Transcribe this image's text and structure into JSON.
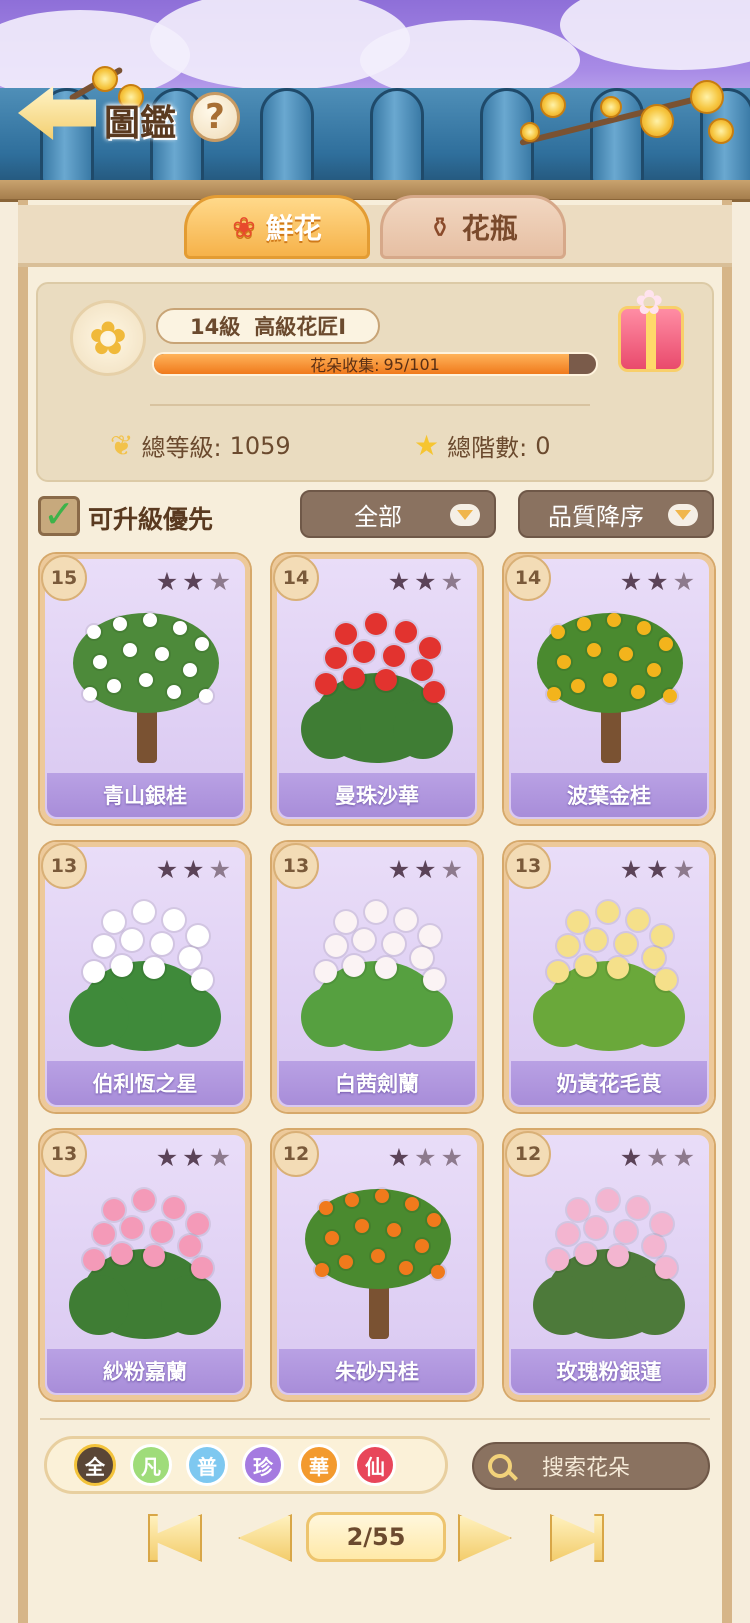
{
  "header": {
    "title": "圖鑑",
    "help_label": "?"
  },
  "tabs": [
    {
      "label": "鮮花",
      "icon": "rose-icon",
      "active": true
    },
    {
      "label": "花瓶",
      "icon": "vase-icon",
      "active": false
    }
  ],
  "player": {
    "level": "14級",
    "rank": "高級花匠Ⅰ",
    "collection_label": "花朵收集:",
    "collection_value": "95/101",
    "collection_progress": 0.94,
    "total_level_label": "總等級:",
    "total_level": "1059",
    "total_stage_label": "總階數:",
    "total_stage": "0"
  },
  "filters": {
    "upgrade_first_label": "可升級優先",
    "upgrade_first_checked": true,
    "category_selected": "全部",
    "sort_selected": "品質降序"
  },
  "cards": [
    {
      "level": "15",
      "stars": 2,
      "name": "青山銀桂",
      "art": "tree-white"
    },
    {
      "level": "14",
      "stars": 2,
      "name": "曼珠沙華",
      "art": "lily-red"
    },
    {
      "level": "14",
      "stars": 2,
      "name": "波葉金桂",
      "art": "tree-gold"
    },
    {
      "level": "13",
      "stars": 2,
      "name": "伯利恆之星",
      "art": "bush-white"
    },
    {
      "level": "13",
      "stars": 2,
      "name": "白茜劍蘭",
      "art": "gladiolus-white"
    },
    {
      "level": "13",
      "stars": 2,
      "name": "奶黃花毛茛",
      "art": "ranunculus-yellow"
    },
    {
      "level": "13",
      "stars": 2,
      "name": "紗粉嘉蘭",
      "art": "lily-pink"
    },
    {
      "level": "12",
      "stars": 1,
      "name": "朱砂丹桂",
      "art": "tree-orange"
    },
    {
      "level": "12",
      "stars": 1,
      "name": "玫瑰粉銀蓮",
      "art": "anemone-pink"
    }
  ],
  "quality_filters": [
    {
      "label": "全",
      "color": "#5a4636"
    },
    {
      "label": "凡",
      "color": "#9fdc7a"
    },
    {
      "label": "普",
      "color": "#7ec8f0"
    },
    {
      "label": "珍",
      "color": "#a57be0"
    },
    {
      "label": "華",
      "color": "#f39a2e"
    },
    {
      "label": "仙",
      "color": "#e8465a"
    }
  ],
  "search": {
    "placeholder": "搜索花朵"
  },
  "pagination": {
    "page": "2/55"
  }
}
